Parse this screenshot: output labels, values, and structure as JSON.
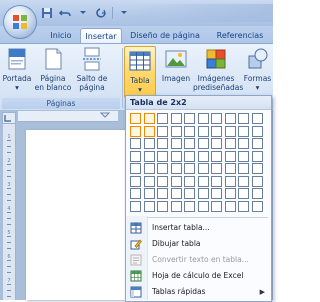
{
  "tabs": [
    {
      "label": "Inicio"
    },
    {
      "label": "Insertar"
    },
    {
      "label": "Diseño de página"
    },
    {
      "label": "Referencias"
    }
  ],
  "ribbon": {
    "group_paginas_label": "Páginas",
    "buttons": {
      "portada": {
        "line1": "Portada",
        "line2": "▾"
      },
      "pagina_en_blanco": {
        "line1": "Página",
        "line2": "en blanco"
      },
      "salto_de_pagina": {
        "line1": "Salto de",
        "line2": "página"
      },
      "tabla": {
        "line1": "Tabla",
        "line2": "▾"
      },
      "imagen": {
        "line1": "Imagen",
        "line2": ""
      },
      "imagenes_prediseniadas": {
        "line1": "Imágenes",
        "line2": "prediseñadas"
      },
      "formas": {
        "line1": "Formas",
        "line2": "▾"
      }
    }
  },
  "table_dropdown": {
    "header": "Tabla de 2x2",
    "grid": {
      "columns": 10,
      "rows": 8,
      "selected_columns": 2,
      "selected_rows": 2
    },
    "items": [
      {
        "label": "Insertar tabla...",
        "icon": "insert-table-icon",
        "disabled": false
      },
      {
        "label": "Dibujar tabla",
        "icon": "draw-table-pencil-icon",
        "disabled": false
      },
      {
        "label": "Convertir texto en tabla...",
        "icon": "convert-text-icon",
        "disabled": true
      },
      {
        "label": "Hoja de cálculo de Excel",
        "icon": "excel-sheet-icon",
        "disabled": false
      },
      {
        "label": "Tablas rápidas",
        "icon": "quick-tables-icon",
        "disabled": false,
        "submenu_arrow": "▶"
      }
    ]
  },
  "ruler": {
    "vertical_numbers": [
      "1",
      "2",
      "3",
      "4",
      "5",
      "6",
      "7"
    ]
  },
  "colors": {
    "selection": "#f08a00",
    "ribbon_text": "#15428b",
    "accent": "#ffcb47"
  }
}
